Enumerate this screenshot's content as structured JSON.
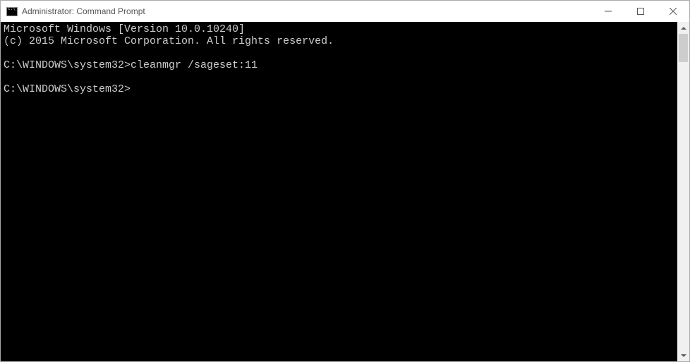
{
  "titlebar": {
    "title": "Administrator: Command Prompt"
  },
  "terminal": {
    "line1": "Microsoft Windows [Version 10.0.10240]",
    "line2": "(c) 2015 Microsoft Corporation. All rights reserved.",
    "prompt1": "C:\\WINDOWS\\system32>",
    "command1": "cleanmgr /sageset:11",
    "prompt2": "C:\\WINDOWS\\system32>"
  }
}
